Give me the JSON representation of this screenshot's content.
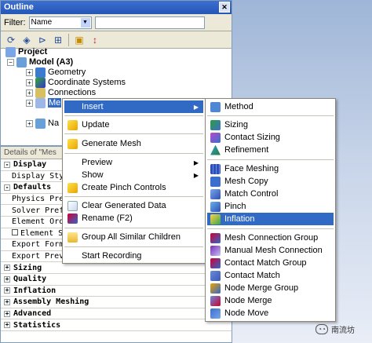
{
  "outline": {
    "title": "Outline",
    "filter_label": "Filter:",
    "filter_value": "Name"
  },
  "tree": {
    "project": "Project",
    "model": "Model (A3)",
    "geometry": "Geometry",
    "coordinate_systems": "Coordinate Systems",
    "connections": "Connections",
    "mesh_partial": "Me",
    "named_partial": "Na"
  },
  "details": {
    "title": "Details of \"Mes",
    "rows": [
      {
        "kind": "group",
        "label": "Display",
        "expander": "-"
      },
      {
        "kind": "row",
        "label": "Display Style"
      },
      {
        "kind": "group",
        "label": "Defaults",
        "expander": "-"
      },
      {
        "kind": "row",
        "label": "Physics Prefe"
      },
      {
        "kind": "row",
        "label": "Solver Prefer"
      },
      {
        "kind": "row",
        "label": "Element Order"
      },
      {
        "kind": "check",
        "label": "Element Si"
      },
      {
        "kind": "row",
        "label": "Export Format"
      },
      {
        "kind": "row",
        "label": "Export Previe"
      },
      {
        "kind": "group",
        "label": "Sizing",
        "expander": "+"
      },
      {
        "kind": "group",
        "label": "Quality",
        "expander": "+"
      },
      {
        "kind": "group",
        "label": "Inflation",
        "expander": "+"
      },
      {
        "kind": "group",
        "label": "Assembly Meshing",
        "expander": "+"
      },
      {
        "kind": "group",
        "label": "Advanced",
        "expander": "+"
      },
      {
        "kind": "group",
        "label": "Statistics",
        "expander": "+"
      }
    ]
  },
  "context_menu": {
    "insert": "Insert",
    "update": "Update",
    "generate_mesh": "Generate Mesh",
    "preview": "Preview",
    "show": "Show",
    "create_pinch_controls": "Create Pinch Controls",
    "clear_generated_data": "Clear Generated Data",
    "rename": "Rename (F2)",
    "group_all": "Group All Similar Children",
    "start_recording": "Start Recording"
  },
  "insert_submenu": {
    "method": "Method",
    "sizing": "Sizing",
    "contact_sizing": "Contact Sizing",
    "refinement": "Refinement",
    "face_meshing": "Face Meshing",
    "mesh_copy": "Mesh Copy",
    "match_control": "Match Control",
    "pinch": "Pinch",
    "inflation": "Inflation",
    "mesh_connection_group": "Mesh Connection Group",
    "manual_mesh_connection": "Manual Mesh Connection",
    "contact_match_group": "Contact Match Group",
    "contact_match": "Contact Match",
    "node_merge_group": "Node Merge Group",
    "node_merge": "Node Merge",
    "node_move": "Node Move"
  },
  "watermark": "南流坊",
  "colors": {
    "highlight": "#316ac5",
    "title_bar": "#2456b8",
    "panel_bg": "#ece9d8"
  }
}
